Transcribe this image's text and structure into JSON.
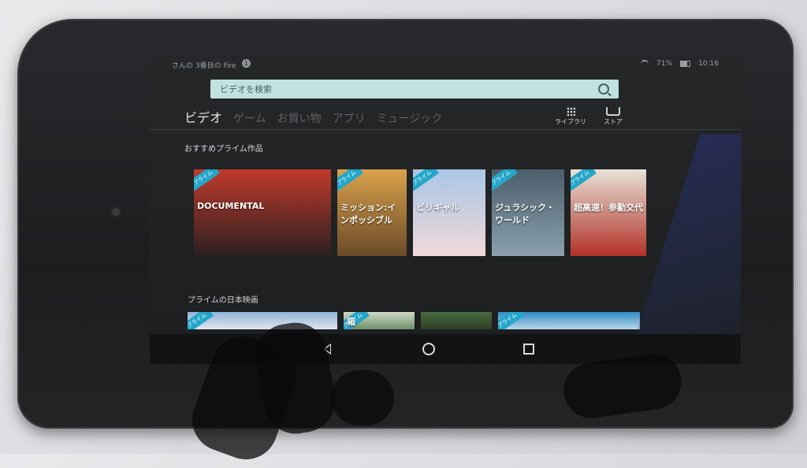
{
  "status_bar": {
    "device_name": "さんの 3番目の Fire",
    "notification_count": "1",
    "battery": "71%",
    "time": "10:16"
  },
  "search": {
    "placeholder": "ビデオを検索"
  },
  "tabs": [
    {
      "label": "ビデオ",
      "active": true
    },
    {
      "label": "ゲーム",
      "active": false
    },
    {
      "label": "お買い物",
      "active": false
    },
    {
      "label": "アプリ",
      "active": false
    },
    {
      "label": "ミュージック",
      "active": false
    }
  ],
  "nav_right": {
    "library_label": "ライブラリ",
    "store_label": "ストア"
  },
  "sections": {
    "recommended_title": "おすすめプライム作品",
    "japanese_movies_title": "プライムの日本映画"
  },
  "recommended_posters": [
    {
      "title": "DOCUMENTAL",
      "badge": "プライム",
      "colors": [
        "#c03a2b",
        "#2b2020"
      ]
    },
    {
      "title": "ミッション:インポッシブル",
      "badge": "プライム",
      "colors": [
        "#d9a24a",
        "#6b4a2a"
      ]
    },
    {
      "title": "ビリギャル",
      "badge": "プライム",
      "colors": [
        "#a8c6e6",
        "#f2d8d8"
      ]
    },
    {
      "title": "ジュラシック・ワールド",
      "badge": "プライム",
      "colors": [
        "#4b5f6b",
        "#8aa0ad"
      ]
    },
    {
      "title": "超高速！参勤交代",
      "badge": "プライム",
      "colors": [
        "#e8e2d6",
        "#b23128"
      ]
    }
  ],
  "japanese_posters": [
    {
      "title": "",
      "badge": "プライム",
      "colors": [
        "#8fb3d9",
        "#e0e6ee"
      ]
    },
    {
      "title": "箱",
      "badge": "プライム",
      "colors": [
        "#cfd8c4",
        "#6f8f6a"
      ]
    },
    {
      "title": "",
      "badge": "",
      "colors": [
        "#4a6b3f",
        "#2c3f25"
      ]
    },
    {
      "title": "",
      "badge": "プライム",
      "colors": [
        "#2f8bc4",
        "#b8d7ea"
      ]
    }
  ],
  "nav_bar": {
    "back": "back-icon",
    "home": "home-icon",
    "recents": "recents-icon"
  }
}
